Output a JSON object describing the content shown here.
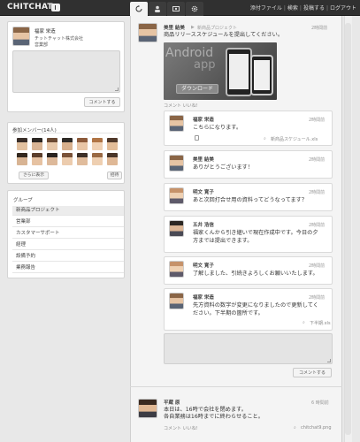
{
  "app": {
    "logo": "CHITCHAT"
  },
  "header_links": [
    "添付ファイル",
    "検索",
    "投稿する",
    "ログアウト"
  ],
  "header_tabs": [
    {
      "icon": "refresh-icon"
    },
    {
      "icon": "user-icon"
    },
    {
      "icon": "album-icon"
    },
    {
      "icon": "gear-icon"
    }
  ],
  "profile": {
    "name": "福家 栄造",
    "company": "チットチャット株式会社",
    "dept": "営業部",
    "comment_button": "コメントする"
  },
  "members": {
    "title": "参加メンバー(14人)",
    "more_button": "さらに表示",
    "invite_button": "招待"
  },
  "groups": {
    "title": "グループ",
    "items": [
      "新商品プロジェクト",
      "営業部",
      "カスタマーサポート",
      "経理",
      "設備予約",
      "業務報告"
    ]
  },
  "post": {
    "author": "美里 結美",
    "arrow": "▶",
    "group": "新商品プロジェクト",
    "time": "2時間前",
    "text": "商品リリーススケジュールを提出してください。",
    "image_title": "Android",
    "image_sub": "app",
    "download_label": "ダウンロード",
    "actions": "コメント いいね!",
    "comment_button": "コメントする"
  },
  "replies": [
    {
      "author": "福家 栄造",
      "time": "2時間前",
      "lines": [
        "こちらになります。"
      ],
      "attachment": "新商品スケジュール.xls"
    },
    {
      "author": "美里 結美",
      "time": "2時間前",
      "lines": [
        "ありがとうございます！"
      ],
      "attachment": ""
    },
    {
      "author": "明文 寛子",
      "time": "2時間前",
      "lines": [
        "あと次回打合せ用の資料ってどうなってます？"
      ],
      "attachment": ""
    },
    {
      "author": "五井 浩信",
      "time": "2時間前",
      "lines": [
        "福家くんから引き継いで現在作成中です。今日の夕",
        "方までは提出できます。"
      ],
      "attachment": ""
    },
    {
      "author": "明文 寛子",
      "time": "2時間前",
      "lines": [
        "了解しました、引続きよろしくお願いいたします。"
      ],
      "attachment": ""
    },
    {
      "author": "福家 栄造",
      "time": "2時間前",
      "lines": [
        "先方資料の数字が変更になりましたので更新してく",
        "ださい。下半期の箇所です。"
      ],
      "attachment": "下半期.xls"
    }
  ],
  "post2": {
    "author": "平蔵 原",
    "time": "6 時間前",
    "lines": [
      "本日は、16時で会社を閉めます。",
      "各自業務は16時までに終わらせること。"
    ],
    "actions": "コメント いいね!",
    "attachment": "chitchat9.png"
  }
}
